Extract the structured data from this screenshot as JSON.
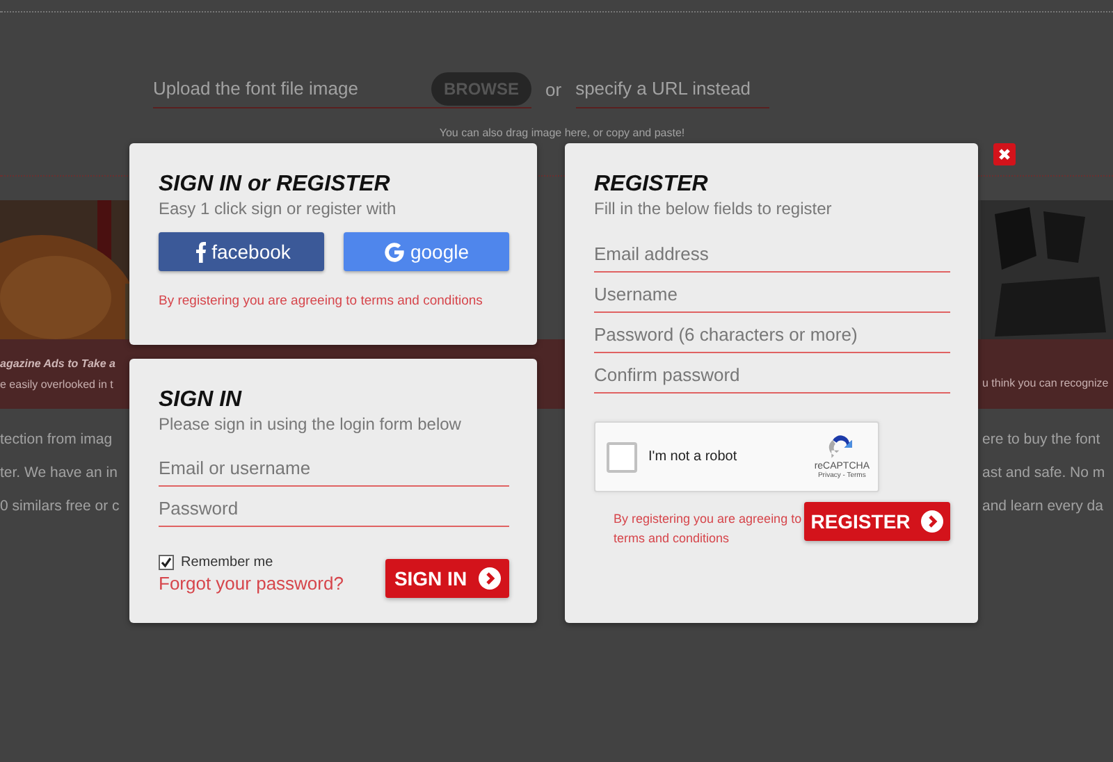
{
  "background": {
    "upload_placeholder": "Upload the font file image",
    "browse_button": "BROWSE",
    "or_label": "or",
    "url_placeholder": "specify a URL instead",
    "drag_hint": "You can also drag image here, or copy and paste!",
    "left_caption_title": "agazine Ads to Take a",
    "left_caption_text": "e easily overlooked in t",
    "right_caption_text": "u think you can recognize",
    "text_left": [
      "tection from imag",
      "ter. We have an in",
      "0 similars free or c"
    ],
    "text_right": [
      "ere to buy the font",
      "ast and safe. No m",
      "and learn every da"
    ]
  },
  "social_card": {
    "title": "SIGN IN or REGISTER",
    "subtitle": "Easy 1 click sign or register with",
    "buttons": [
      {
        "kind": "facebook",
        "label": "facebook"
      },
      {
        "kind": "google",
        "label": "google"
      }
    ],
    "terms": "By registering you are agreeing to terms and conditions"
  },
  "sign_in": {
    "title": "SIGN IN",
    "subtitle": "Please sign in using the login form below",
    "fields": [
      {
        "placeholder": "Email or username"
      },
      {
        "placeholder": "Password"
      }
    ],
    "remember": {
      "label": "Remember me",
      "checked": true
    },
    "forgot_link": "Forgot your password?",
    "submit": "SIGN IN"
  },
  "register": {
    "title": "REGISTER",
    "subtitle": "Fill in the below fields to register",
    "fields": [
      {
        "placeholder": "Email address"
      },
      {
        "placeholder": "Username"
      },
      {
        "placeholder": "Password (6 characters or more)"
      },
      {
        "placeholder": "Confirm password"
      }
    ],
    "captcha": {
      "label": "I'm not a robot",
      "checked": false,
      "brand": "reCAPTCHA",
      "links": "Privacy - Terms"
    },
    "terms": "By registering you are agreeing to terms and conditions",
    "submit": "REGISTER"
  }
}
